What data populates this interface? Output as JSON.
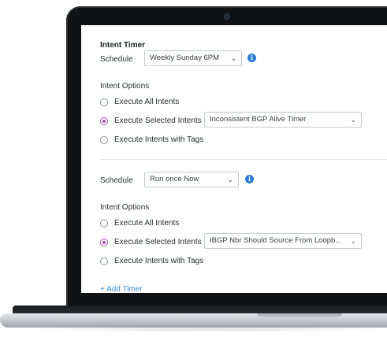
{
  "timer1": {
    "title": "Intent Timer",
    "schedule_label": "Schedule",
    "schedule_value": "Weekly Sunday 6PM",
    "options_label": "Intent Options",
    "options": [
      {
        "label": "Execute All Intents",
        "selected": false
      },
      {
        "label": "Execute Selected Intents",
        "selected": true
      },
      {
        "label": "Execute Intents with Tags",
        "selected": false
      }
    ],
    "selected_intent": "Inconsistent BGP Alive Timer"
  },
  "timer2": {
    "schedule_label": "Schedule",
    "schedule_value": "Run once Now",
    "options_label": "Intent Options",
    "options": [
      {
        "label": "Execute All Intents",
        "selected": false
      },
      {
        "label": "Execute Selected Intents",
        "selected": true
      },
      {
        "label": "Execute Intents with Tags",
        "selected": false
      }
    ],
    "selected_intent": "IBGP Nbr Should Source From Loopb..."
  },
  "add_timer_label": "+ Add Timer",
  "colors": {
    "accent_radio": "#a84fb3",
    "info_icon": "#2e7bd6",
    "link": "#3d8fd8"
  }
}
